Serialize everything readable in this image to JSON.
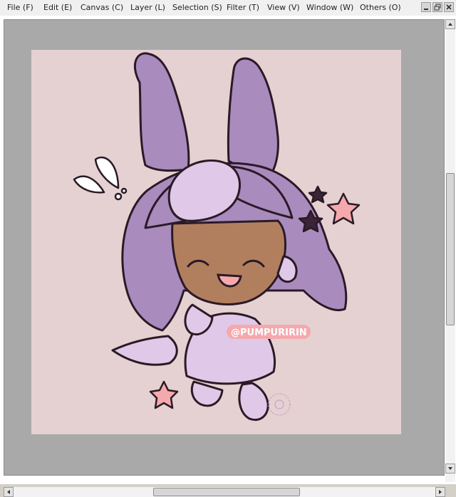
{
  "menu": [
    {
      "id": "file",
      "label": "File (F)"
    },
    {
      "id": "edit",
      "label": "Edit (E)"
    },
    {
      "id": "canvas",
      "label": "Canvas (C)"
    },
    {
      "id": "layer",
      "label": "Layer (L)"
    },
    {
      "id": "selection",
      "label": "Selection (S)"
    },
    {
      "id": "filter",
      "label": "Filter (T)"
    },
    {
      "id": "view",
      "label": "View (V)"
    },
    {
      "id": "window",
      "label": "Window (W)"
    },
    {
      "id": "others",
      "label": "Others (O)"
    }
  ],
  "window_controls": {
    "minimize": "minimize-icon",
    "restore": "restore-icon",
    "close": "close-icon"
  },
  "artwork": {
    "watermark": "@PUMPURIRIN",
    "paper_color": "#e5d1d1",
    "hair_color": "#a98bbe",
    "skin_color": "#b27f5e",
    "accent_color": "#f5a9ad"
  },
  "scrollbars": {
    "vertical": "vertical-scrollbar",
    "horizontal": "horizontal-scrollbar"
  }
}
